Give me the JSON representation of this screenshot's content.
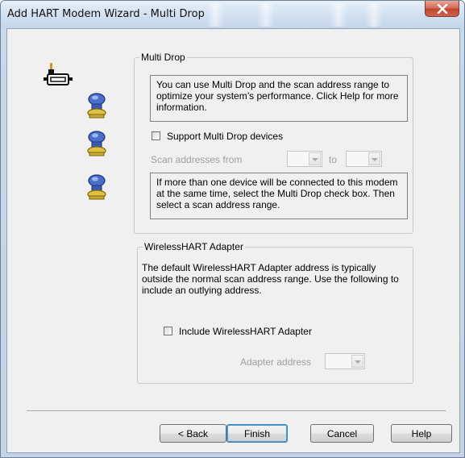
{
  "window": {
    "title": "Add HART Modem Wizard - Multi Drop",
    "close_icon": "close-x-icon"
  },
  "illustration": {
    "modem_icon": "modem-connector-icon",
    "device_icons": [
      "hart-device-icon",
      "hart-device-icon",
      "hart-device-icon"
    ]
  },
  "multidrop": {
    "legend": "Multi Drop",
    "info": "You can use Multi Drop and the scan address range to optimize your system’s performance. Click Help for more information.",
    "support_checkbox": {
      "label": "Support Multi Drop devices",
      "checked": false
    },
    "scan_label": "Scan addresses from",
    "to_label": "to",
    "scan_from_value": "",
    "scan_to_value": "",
    "note": "If more than one device will be connected to this modem at the same time, select the Multi Drop check box. Then select a scan address range."
  },
  "wireless": {
    "legend": "WirelessHART Adapter",
    "description": "The default WirelessHART Adapter address is typically outside the normal scan address range.  Use the following to include an outlying address.",
    "include_checkbox": {
      "label": "Include WirelessHART Adapter",
      "checked": false
    },
    "adapter_address_label": "Adapter address",
    "adapter_address_value": ""
  },
  "buttons": {
    "back": "< Back",
    "finish": "Finish",
    "cancel": "Cancel",
    "help": "Help"
  },
  "colors": {
    "titlebar": "#d3e1f1",
    "close_button": "#c0452e",
    "dialog_background": "#f0f0f0",
    "default_button_border": "#3c7fb1"
  }
}
